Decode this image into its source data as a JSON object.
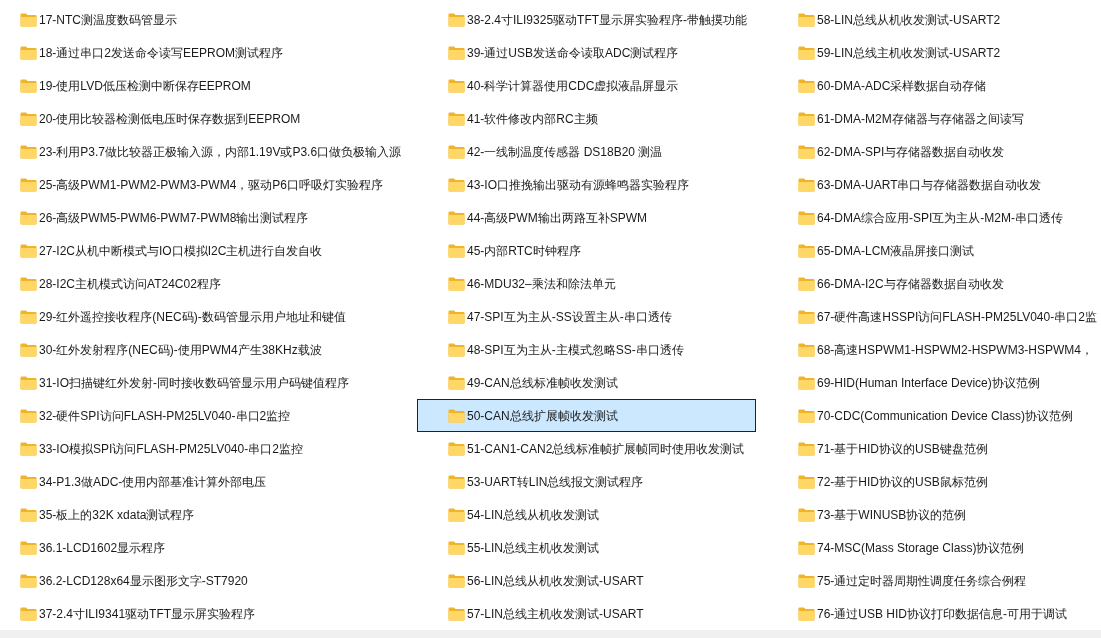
{
  "columns": [
    {
      "items": [
        {
          "name": "17-NTC测温度数码管显示",
          "selected": false
        },
        {
          "name": "18-通过串口2发送命令读写EEPROM测试程序",
          "selected": false
        },
        {
          "name": "19-使用LVD低压检测中断保存EEPROM",
          "selected": false
        },
        {
          "name": "20-使用比较器检测低电压时保存数据到EEPROM",
          "selected": false
        },
        {
          "name": "23-利用P3.7做比较器正极输入源，内部1.19V或P3.6口做负极输入源",
          "selected": false
        },
        {
          "name": "25-高级PWM1-PWM2-PWM3-PWM4，驱动P6口呼吸灯实验程序",
          "selected": false
        },
        {
          "name": "26-高级PWM5-PWM6-PWM7-PWM8输出测试程序",
          "selected": false
        },
        {
          "name": "27-I2C从机中断模式与IO口模拟I2C主机进行自发自收",
          "selected": false
        },
        {
          "name": "28-I2C主机模式访问AT24C02程序",
          "selected": false
        },
        {
          "name": "29-红外遥控接收程序(NEC码)-数码管显示用户地址和键值",
          "selected": false
        },
        {
          "name": "30-红外发射程序(NEC码)-使用PWM4产生38KHz载波",
          "selected": false
        },
        {
          "name": "31-IO扫描键红外发射-同时接收数码管显示用户码键值程序",
          "selected": false
        },
        {
          "name": "32-硬件SPI访问FLASH-PM25LV040-串口2监控",
          "selected": false
        },
        {
          "name": "33-IO模拟SPI访问FLASH-PM25LV040-串口2监控",
          "selected": false
        },
        {
          "name": "34-P1.3做ADC-使用内部基准计算外部电压",
          "selected": false
        },
        {
          "name": "35-板上的32K xdata测试程序",
          "selected": false
        },
        {
          "name": "36.1-LCD1602显示程序",
          "selected": false
        },
        {
          "name": "36.2-LCD128x64显示图形文字-ST7920",
          "selected": false
        },
        {
          "name": "37-2.4寸ILI9341驱动TFT显示屏实验程序",
          "selected": false
        }
      ]
    },
    {
      "items": [
        {
          "name": "38-2.4寸ILI9325驱动TFT显示屏实验程序-带触摸功能",
          "selected": false
        },
        {
          "name": "39-通过USB发送命令读取ADC测试程序",
          "selected": false
        },
        {
          "name": "40-科学计算器使用CDC虚拟液晶屏显示",
          "selected": false
        },
        {
          "name": "41-软件修改内部RC主频",
          "selected": false
        },
        {
          "name": "42-一线制温度传感器 DS18B20 测温",
          "selected": false
        },
        {
          "name": "43-IO口推挽输出驱动有源蜂鸣器实验程序",
          "selected": false
        },
        {
          "name": "44-高级PWM输出两路互补SPWM",
          "selected": false
        },
        {
          "name": "45-内部RTC时钟程序",
          "selected": false
        },
        {
          "name": "46-MDU32–乘法和除法单元",
          "selected": false
        },
        {
          "name": "47-SPI互为主从-SS设置主从-串口透传",
          "selected": false
        },
        {
          "name": "48-SPI互为主从-主模式忽略SS-串口透传",
          "selected": false
        },
        {
          "name": "49-CAN总线标准帧收发测试",
          "selected": false
        },
        {
          "name": "50-CAN总线扩展帧收发测试",
          "selected": true
        },
        {
          "name": "51-CAN1-CAN2总线标准帧扩展帧同时使用收发测试",
          "selected": false
        },
        {
          "name": "53-UART转LIN总线报文测试程序",
          "selected": false
        },
        {
          "name": "54-LIN总线从机收发测试",
          "selected": false
        },
        {
          "name": "55-LIN总线主机收发测试",
          "selected": false
        },
        {
          "name": "56-LIN总线从机收发测试-USART",
          "selected": false
        },
        {
          "name": "57-LIN总线主机收发测试-USART",
          "selected": false
        }
      ]
    },
    {
      "items": [
        {
          "name": "58-LIN总线从机收发测试-USART2",
          "selected": false
        },
        {
          "name": "59-LIN总线主机收发测试-USART2",
          "selected": false
        },
        {
          "name": "60-DMA-ADC采样数据自动存储",
          "selected": false
        },
        {
          "name": "61-DMA-M2M存储器与存储器之间读写",
          "selected": false
        },
        {
          "name": "62-DMA-SPI与存储器数据自动收发",
          "selected": false
        },
        {
          "name": "63-DMA-UART串口与存储器数据自动收发",
          "selected": false
        },
        {
          "name": "64-DMA综合应用-SPI互为主从-M2M-串口透传",
          "selected": false
        },
        {
          "name": "65-DMA-LCM液晶屏接口测试",
          "selected": false
        },
        {
          "name": "66-DMA-I2C与存储器数据自动收发",
          "selected": false
        },
        {
          "name": "67-硬件高速HSSPI访问FLASH-PM25LV040-串口2监",
          "selected": false
        },
        {
          "name": "68-高速HSPWM1-HSPWM2-HSPWM3-HSPWM4，",
          "selected": false
        },
        {
          "name": "69-HID(Human Interface Device)协议范例",
          "selected": false
        },
        {
          "name": "70-CDC(Communication Device Class)协议范例",
          "selected": false
        },
        {
          "name": "71-基于HID协议的USB键盘范例",
          "selected": false
        },
        {
          "name": "72-基于HID协议的USB鼠标范例",
          "selected": false
        },
        {
          "name": "73-基于WINUSB协议的范例",
          "selected": false
        },
        {
          "name": "74-MSC(Mass Storage Class)协议范例",
          "selected": false
        },
        {
          "name": "75-通过定时器周期性调度任务综合例程",
          "selected": false
        },
        {
          "name": "76-通过USB HID协议打印数据信息-可用于调试",
          "selected": false
        }
      ]
    }
  ]
}
